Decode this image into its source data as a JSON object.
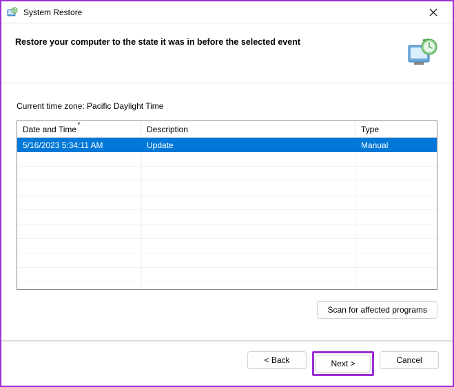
{
  "titlebar": {
    "title": "System Restore"
  },
  "header": {
    "text": "Restore your computer to the state it was in before the selected event"
  },
  "content": {
    "timezone_label": "Current time zone: Pacific Daylight Time",
    "columns": {
      "datetime": "Date and Time",
      "description": "Description",
      "type": "Type"
    },
    "rows": [
      {
        "datetime": "5/16/2023 5:34:11 AM",
        "description": "Update",
        "type": "Manual"
      }
    ],
    "scan_button": "Scan for affected programs"
  },
  "footer": {
    "back": "< Back",
    "next": "Next >",
    "cancel": "Cancel"
  }
}
